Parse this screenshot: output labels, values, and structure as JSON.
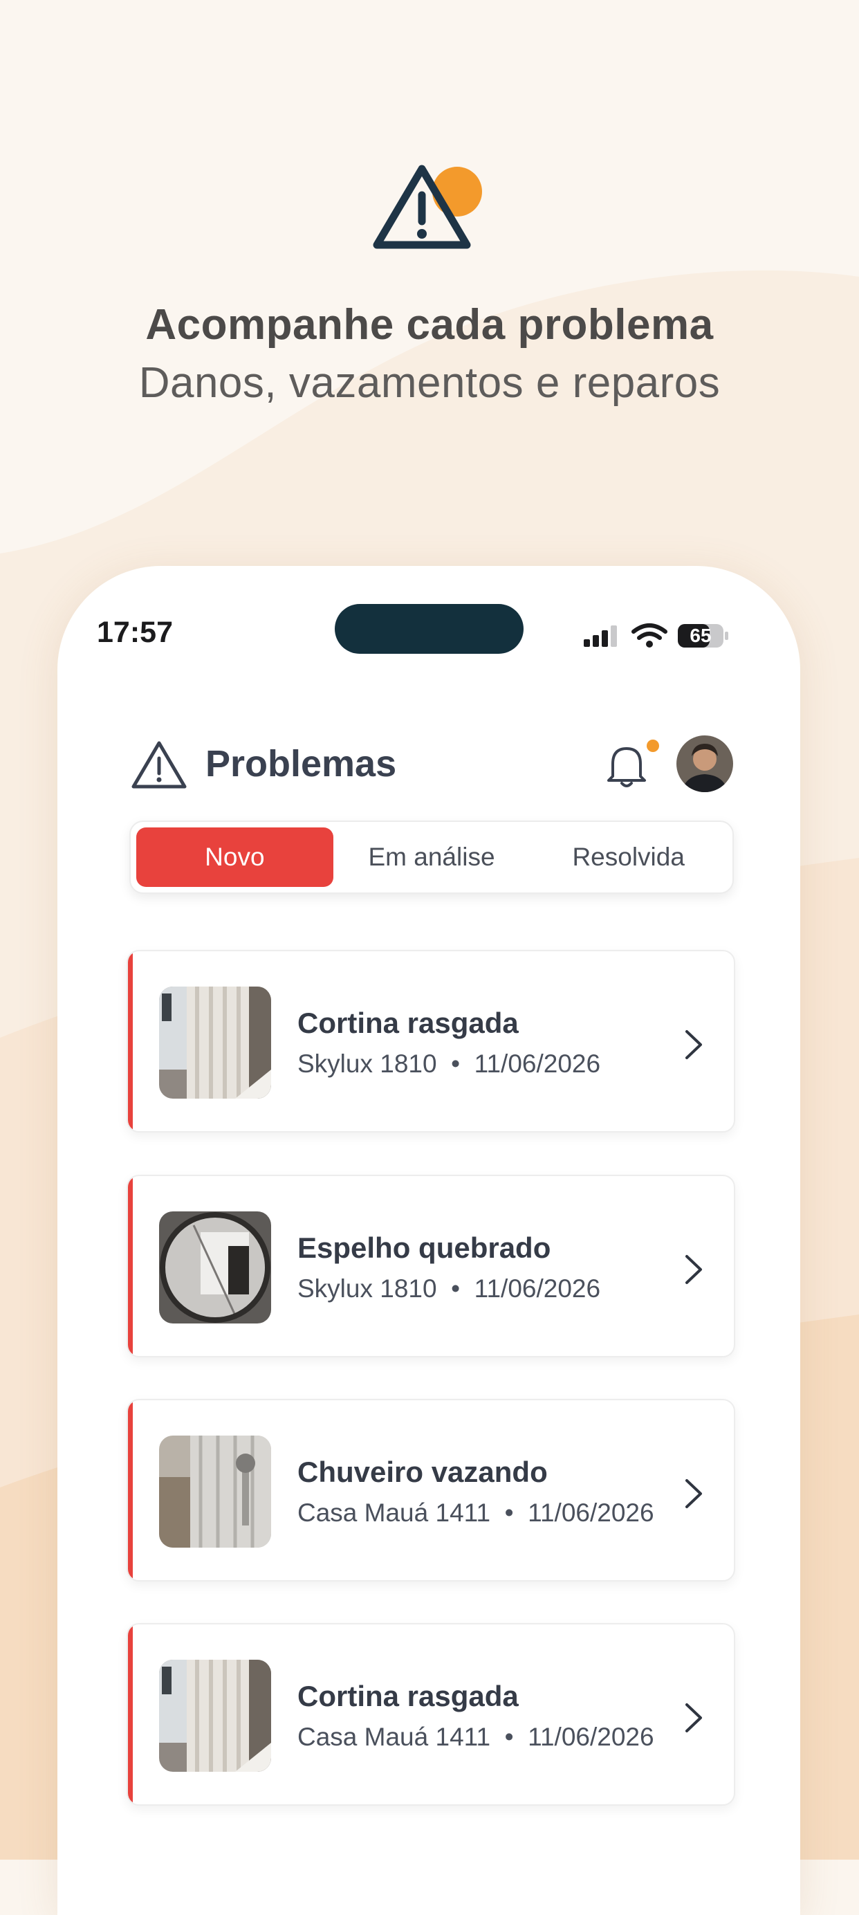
{
  "hero": {
    "icon": "warning-triangle-icon",
    "accent": "#f39a2c",
    "title": "Acompanhe cada problema",
    "subtitle": "Danos, vazamentos e reparos"
  },
  "status_bar": {
    "time": "17:57",
    "battery": "65",
    "icons": [
      "signal-icon",
      "wifi-icon",
      "battery-icon"
    ]
  },
  "header": {
    "icon": "warning-triangle-icon",
    "title": "Problemas",
    "notification_icon": "bell-icon",
    "notification_dot_color": "#f39a2c"
  },
  "tabs": [
    {
      "label": "Novo",
      "active": true
    },
    {
      "label": "Em análise",
      "active": false
    },
    {
      "label": "Resolvida",
      "active": false
    }
  ],
  "accent_color": "#e8423d",
  "issues": [
    {
      "title": "Cortina rasgada",
      "property": "Skylux 1810",
      "date": "11/06/2026",
      "meta": "Skylux 1810  •  11/06/2026"
    },
    {
      "title": "Espelho quebrado",
      "property": "Skylux 1810",
      "date": "11/06/2026",
      "meta": "Skylux 1810  •  11/06/2026"
    },
    {
      "title": "Chuveiro vazando",
      "property": "Casa Mauá 1411",
      "date": "11/06/2026",
      "meta": "Casa Mauá 1411  •  11/06/2026"
    },
    {
      "title": "Cortina rasgada",
      "property": "Casa Mauá 1411",
      "date": "11/06/2026",
      "meta": "Casa Mauá 1411  •  11/06/2026"
    }
  ]
}
